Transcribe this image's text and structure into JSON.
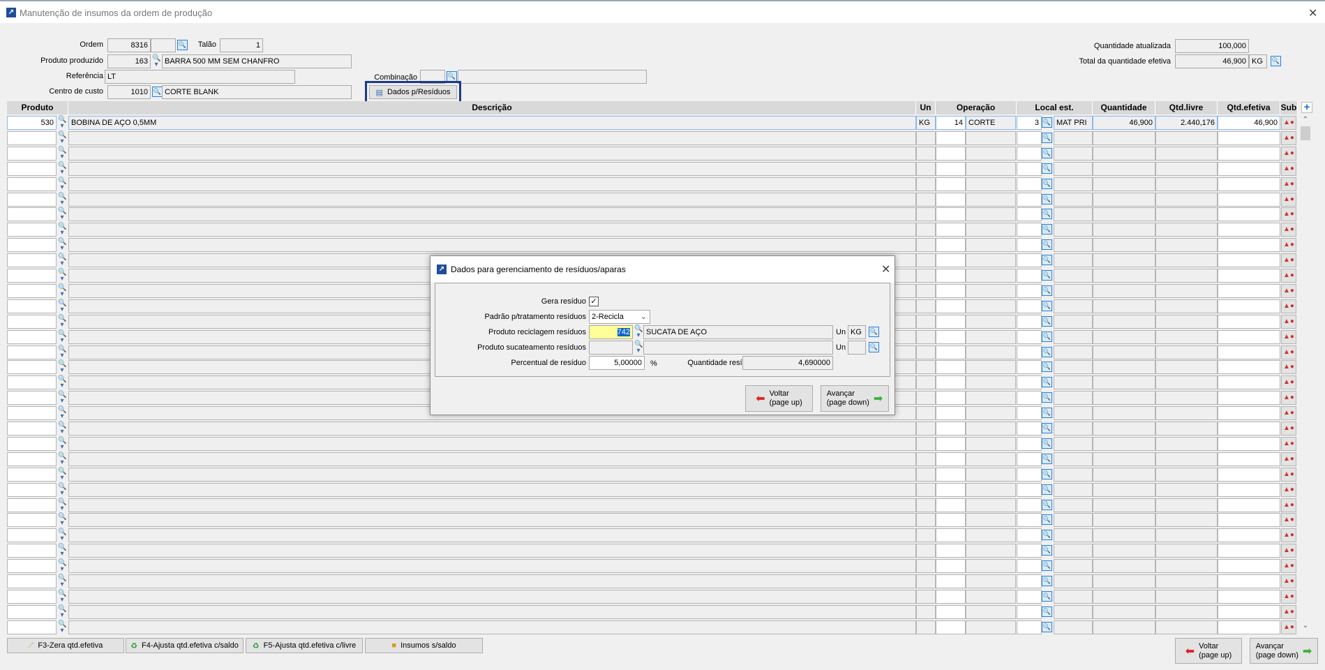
{
  "window": {
    "title": "Manutenção de insumos da ordem de produção",
    "close": "✕"
  },
  "header": {
    "ordem_label": "Ordem",
    "ordem": "8316",
    "ordem2": "",
    "talao_label": "Talão",
    "talao": "1",
    "produto_label": "Produto produzido",
    "produto_code": "163",
    "produto_desc": "BARRA 500 MM SEM CHANFRO",
    "referencia_label": "Referência",
    "referencia": "LT",
    "combinacao_label": "Combinação",
    "combinacao": "",
    "combinacao_desc": "",
    "centro_label": "Centro de custo",
    "centro_code": "1010",
    "centro_desc": "CORTE BLANK",
    "dados_residuos_button": "Dados p/Resíduos",
    "qtd_atualizada_label": "Quantidade atualizada",
    "qtd_atualizada": "100,000",
    "total_efetiva_label": "Total da quantidade efetiva",
    "total_efetiva": "46,900",
    "total_un": "KG"
  },
  "grid": {
    "columns": [
      "Produto",
      "Descrição",
      "Un",
      "Operação",
      "Local est.",
      "Quantidade",
      "Qtd.livre",
      "Qtd.efetiva",
      "Sub"
    ],
    "add": "+",
    "rows": [
      {
        "produto": "530",
        "descricao": "BOBINA DE AÇO 0,5MM",
        "un": "KG",
        "op_code": "14",
        "op_desc": "CORTE",
        "local_code": "3",
        "local_desc": "MAT PRI",
        "quantidade": "46,900",
        "qtd_livre": "2.440,176",
        "qtd_efetiva": "46,900"
      }
    ],
    "empty_rows": 33
  },
  "footer": {
    "f3": "F3-Zera qtd.efetiva",
    "f4": "F4-Ajusta qtd.efetiva c/saldo",
    "f5": "F5-Ajusta qtd.efetiva c/livre",
    "insumos": "Insumos s/saldo",
    "voltar": "Voltar",
    "voltar_sub": "(page up)",
    "avancar": "Avançar",
    "avancar_sub": "(page down)"
  },
  "dialog": {
    "title": "Dados para gerenciamento de resíduos/aparas",
    "close": "✕",
    "gera_label": "Gera resíduo",
    "gera_checked": true,
    "padrao_label": "Padrão p/tratamento resíduos",
    "padrao": "2-Recicla",
    "recic_label": "Produto reciclagem resíduos",
    "recic_code": "742",
    "recic_desc": "SUCATA DE AÇO",
    "un_label": "Un",
    "recic_un": "KG",
    "sucat_label": "Produto sucateamento resíduos",
    "sucat_code": "",
    "sucat_desc": "",
    "sucat_un": "",
    "perc_label": "Percentual de resíduo",
    "perc": "5,00000",
    "perc_unit": "%",
    "qtd_label": "Quantidade resíduo",
    "qtd": "4,690000",
    "voltar": "Voltar",
    "voltar_sub": "(page up)",
    "avancar": "Avançar",
    "avancar_sub": "(page down)"
  }
}
